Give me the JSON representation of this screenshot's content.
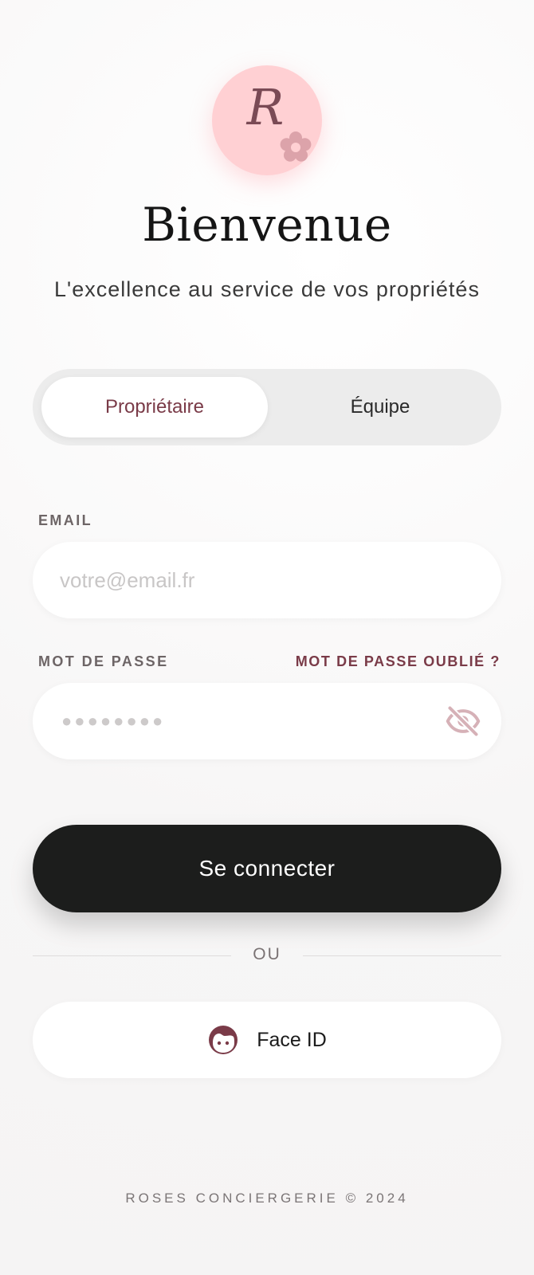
{
  "logo": {
    "letter": "R",
    "icon": "flower-icon"
  },
  "header": {
    "title": "Bienvenue",
    "subtitle": "L'excellence au service de vos propriétés"
  },
  "segments": {
    "active": "Propriétaire",
    "inactive": "Équipe"
  },
  "form": {
    "email_label": "EMAIL",
    "email_placeholder": "votre@email.fr",
    "email_value": "",
    "password_label": "MOT DE PASSE",
    "forgot_link": "MOT DE PASSE OUBLIÉ ?",
    "password_mask": "●●●●●●●●",
    "password_icon": "eye-off-icon"
  },
  "actions": {
    "login_label": "Se connecter",
    "divider_text": "OU",
    "faceid_label": "Face ID",
    "faceid_icon": "face-icon"
  },
  "footer": {
    "text": "ROSES CONCIERGERIE © 2024"
  },
  "colors": {
    "accent": "#7a3b48",
    "logo_bg": "#ffd0d3",
    "primary_button": "#1c1d1c",
    "page_bg": "#f7f6f6"
  }
}
